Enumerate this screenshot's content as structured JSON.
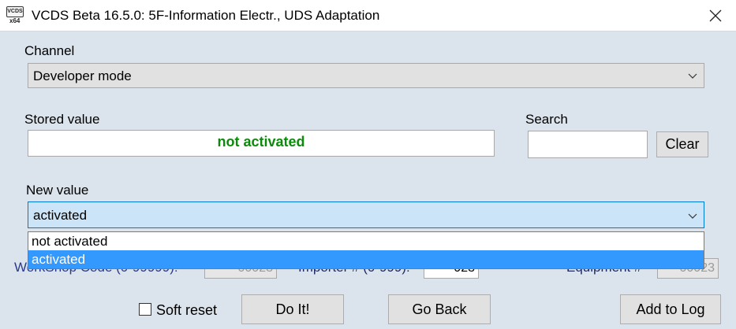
{
  "window": {
    "title": "VCDS Beta 16.5.0: 5F-Information Electr.,  UDS Adaptation",
    "icon_top": "VCDS",
    "icon_bottom": "x64",
    "close_glyph": "✕"
  },
  "channel": {
    "label": "Channel",
    "value": "Developer mode"
  },
  "stored": {
    "label": "Stored value",
    "value": "not activated",
    "value_color": "#0c8a0c"
  },
  "search": {
    "label": "Search",
    "value": "",
    "clear_label": "Clear"
  },
  "new_value": {
    "label": "New value",
    "value": "activated",
    "options": [
      "not activated",
      "activated"
    ],
    "selected_index": 1
  },
  "partially_hidden": {
    "workshop_label": "WorkShop Code (0-99999):",
    "workshop_value": "00023",
    "importer_label": "Importer # (0-999):",
    "importer_value": "023",
    "equipment_label": "Equipment #",
    "equipment_value": "00023"
  },
  "footer": {
    "soft_reset_label": "Soft reset",
    "soft_reset_checked": false,
    "doit_label": "Do It!",
    "goback_label": "Go Back",
    "addlog_label": "Add to Log"
  },
  "colors": {
    "client_bg": "#dbe3ec",
    "selection": "#3399ff",
    "combo_focus_bg": "#cce4f7",
    "combo_focus_border": "#0078d7"
  }
}
